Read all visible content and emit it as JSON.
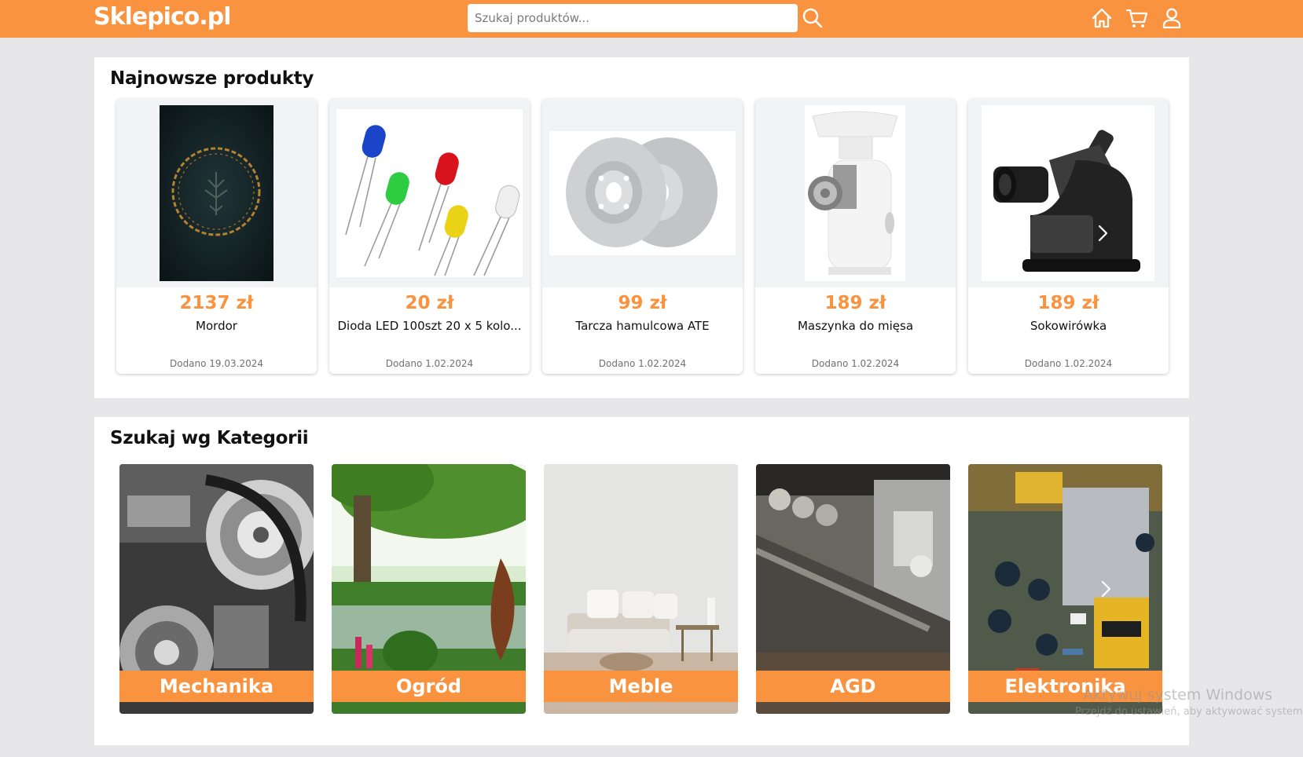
{
  "header": {
    "logo": "Sklepico.pl",
    "search_placeholder": "Szukaj produktów...",
    "search_icon": "search-icon",
    "icons": [
      "home-icon",
      "cart-icon",
      "user-icon"
    ],
    "accent_color": "#fa9340"
  },
  "newest": {
    "title": "Najnowsze produkty",
    "products": [
      {
        "price": "2137 zł",
        "name": "Mordor",
        "date": "Dodano 19.03.2024"
      },
      {
        "price": "20 zł",
        "name": "Dioda LED 100szt 20 x 5 kolo...",
        "date": "Dodano 1.02.2024"
      },
      {
        "price": "99 zł",
        "name": "Tarcza hamulcowa ATE",
        "date": "Dodano 1.02.2024"
      },
      {
        "price": "189 zł",
        "name": "Maszynka do mięsa",
        "date": "Dodano 1.02.2024"
      },
      {
        "price": "189 zł",
        "name": "Sokowirówka",
        "date": "Dodano 1.02.2024"
      }
    ]
  },
  "categories": {
    "title": "Szukaj wg Kategorii",
    "items": [
      {
        "label": "Mechanika"
      },
      {
        "label": "Ogród"
      },
      {
        "label": "Meble"
      },
      {
        "label": "AGD"
      },
      {
        "label": "Elektronika"
      }
    ]
  },
  "watermark": {
    "line1": "Aktywuj system Windows",
    "line2": "Przejdź do ustawień, aby aktywować system"
  }
}
